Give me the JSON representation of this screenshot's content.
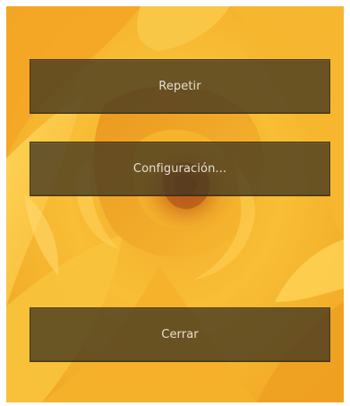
{
  "dialog": {
    "background": "yellow-rose-image",
    "accent_color": "#F7B82B",
    "button_color": "#463A20",
    "buttons": {
      "repeat_label": "Repetir",
      "settings_label": "Configuración...",
      "close_label": "Cerrar"
    }
  }
}
